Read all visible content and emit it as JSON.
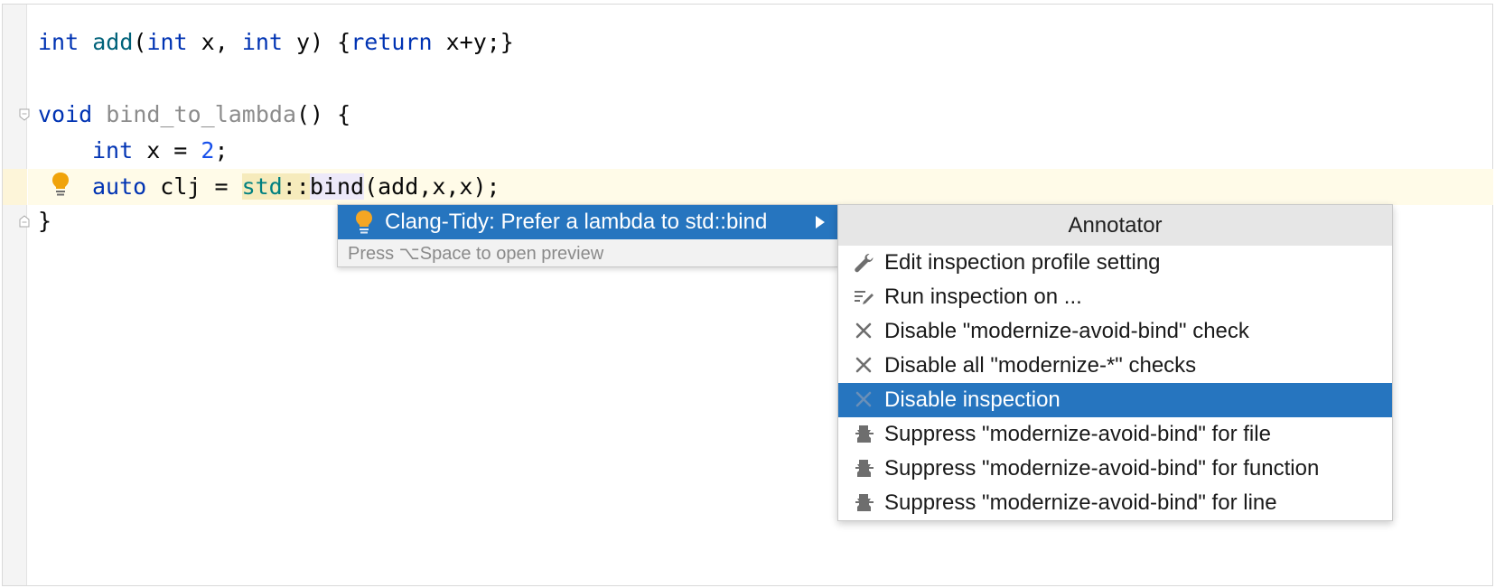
{
  "code": {
    "line1": {
      "kw1": "int",
      "fn": "add",
      "p1": "(",
      "kw2": "int",
      "p2": " x, ",
      "kw3": "int",
      "p3": " y) {",
      "kw4": "return",
      "p4": " x+y;}"
    },
    "line3": {
      "kw": "void",
      "fn": "bind_to_lambda",
      "rest": "() {"
    },
    "line4": {
      "kw": "int",
      "mid": " x = ",
      "num": "2",
      "end": ";"
    },
    "line5": {
      "kw": "auto",
      "mid": " clj = ",
      "ns": "std",
      "sep": "::",
      "fn": "bind",
      "rest": "(add,x,x);"
    },
    "line6": {
      "text": "}"
    }
  },
  "intention_popup": {
    "label": "Clang-Tidy: Prefer a lambda to std::bind",
    "hint": "Press ⌥Space to open preview"
  },
  "submenu": {
    "header": "Annotator",
    "items": [
      {
        "label": "Edit inspection profile setting",
        "icon": "wrench-icon"
      },
      {
        "label": "Run inspection on ...",
        "icon": "run-inspection-icon"
      },
      {
        "label": "Disable \"modernize-avoid-bind\" check",
        "icon": "close-icon"
      },
      {
        "label": "Disable all \"modernize-*\" checks",
        "icon": "close-icon"
      },
      {
        "label": "Disable inspection",
        "icon": "close-icon",
        "selected": true
      },
      {
        "label": "Suppress \"modernize-avoid-bind\" for file",
        "icon": "suppress-icon"
      },
      {
        "label": "Suppress \"modernize-avoid-bind\" for function",
        "icon": "suppress-icon"
      },
      {
        "label": "Suppress \"modernize-avoid-bind\" for line",
        "icon": "suppress-icon"
      }
    ]
  },
  "colors": {
    "selection": "#2675bf",
    "keyword": "#0033b3",
    "function": "#00627a",
    "number": "#1750eb",
    "bulb": "#f0a30a"
  }
}
